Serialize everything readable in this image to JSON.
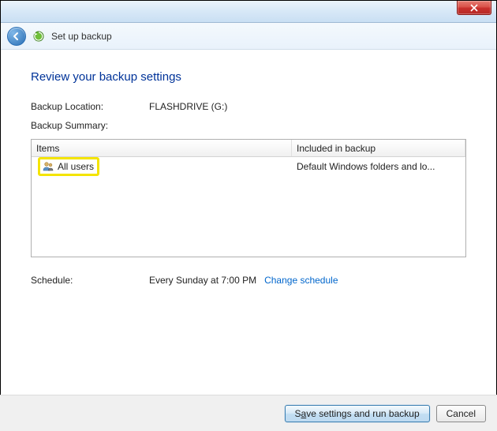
{
  "window": {
    "title": "Set up backup"
  },
  "heading": "Review your backup settings",
  "location": {
    "label": "Backup Location:",
    "value": "FLASHDRIVE (G:)"
  },
  "summaryLabel": "Backup Summary:",
  "columns": {
    "items": "Items",
    "included": "Included in backup"
  },
  "rows": [
    {
      "name": "All users",
      "included": "Default Windows folders and lo..."
    }
  ],
  "schedule": {
    "label": "Schedule:",
    "value": "Every Sunday at 7:00 PM",
    "link": "Change schedule"
  },
  "buttons": {
    "primary_pre": "S",
    "primary_u": "a",
    "primary_post": "ve settings and run backup",
    "cancel": "Cancel"
  }
}
